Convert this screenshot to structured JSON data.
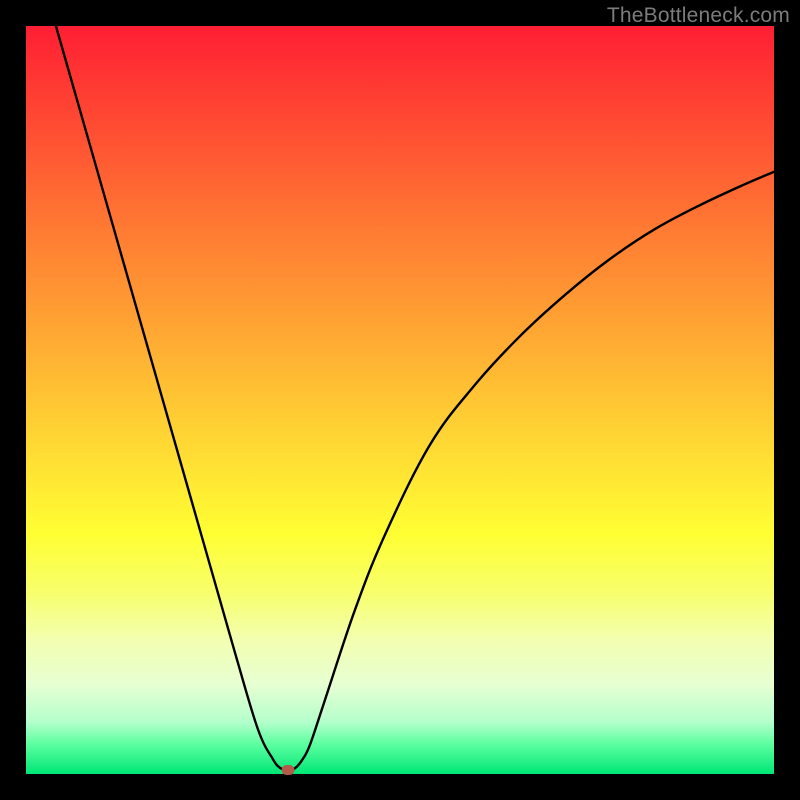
{
  "watermark": "TheBottleneck.com",
  "chart_data": {
    "type": "line",
    "title": "",
    "xlabel": "",
    "ylabel": "",
    "xlim": [
      0,
      100
    ],
    "ylim": [
      0,
      100
    ],
    "grid": false,
    "legend": false,
    "series": [
      {
        "name": "bottleneck-curve",
        "x": [
          4,
          8,
          12,
          16,
          20,
          24,
          28,
          31,
          33,
          34,
          35,
          36,
          37,
          38,
          40,
          44,
          48,
          54,
          60,
          66,
          72,
          78,
          84,
          90,
          96,
          100
        ],
        "y": [
          100,
          86,
          72,
          58,
          44,
          30,
          16,
          6,
          2,
          0.8,
          0.5,
          0.8,
          2,
          4,
          10,
          22,
          32,
          44,
          52,
          58.5,
          64,
          68.8,
          72.8,
          76,
          78.8,
          80.5
        ]
      }
    ],
    "min_point": {
      "x": 35,
      "y": 0.5
    },
    "gradient": {
      "top_color": "#ff1e33",
      "mid_color": "#ffff33",
      "bottom_color": "#00e676"
    }
  }
}
